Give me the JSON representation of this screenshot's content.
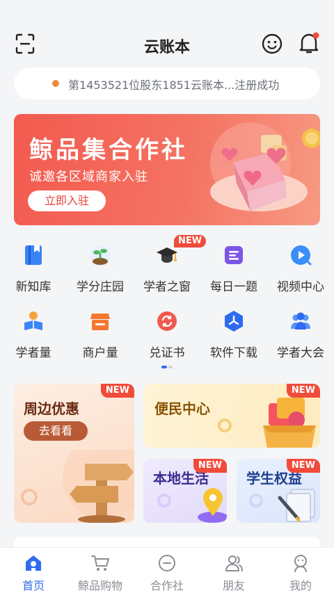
{
  "header": {
    "title": "云账本"
  },
  "notice": {
    "text": "第1453521位股东1851云账本...注册成功"
  },
  "banner": {
    "title": "鲸品集合作社",
    "subtitle": "诚邀各区域商家入驻",
    "button_label": "立即入驻"
  },
  "shortcuts": {
    "row1": [
      {
        "label": "新知库",
        "icon": "book-icon"
      },
      {
        "label": "学分庄园",
        "icon": "sprout-icon"
      },
      {
        "label": "学者之窗",
        "icon": "graduation-cap-icon",
        "badge": "NEW"
      },
      {
        "label": "每日一题",
        "icon": "list-icon"
      },
      {
        "label": "视频中心",
        "icon": "play-icon"
      }
    ],
    "row2": [
      {
        "label": "学者量",
        "icon": "reader-icon"
      },
      {
        "label": "商户量",
        "icon": "shop-icon"
      },
      {
        "label": "兑证书",
        "icon": "exchange-icon"
      },
      {
        "label": "软件下载",
        "icon": "hexagon-icon"
      },
      {
        "label": "学者大会",
        "icon": "people-icon"
      }
    ]
  },
  "cards": {
    "nearby": {
      "title": "周边优惠",
      "button_label": "去看看",
      "badge": "NEW"
    },
    "service": {
      "title": "便民中心",
      "badge": "NEW"
    },
    "local": {
      "title": "本地生活",
      "badge": "NEW"
    },
    "student": {
      "title": "学生权益",
      "badge": "NEW"
    }
  },
  "tabbar": {
    "items": [
      {
        "label": "首页",
        "active": true
      },
      {
        "label": "鲸品购物"
      },
      {
        "label": "合作社"
      },
      {
        "label": "朋友"
      },
      {
        "label": "我的"
      }
    ]
  },
  "colors": {
    "accent": "#2f6bf0",
    "badge": "#f04c3b",
    "banner": "#f35a4f"
  }
}
